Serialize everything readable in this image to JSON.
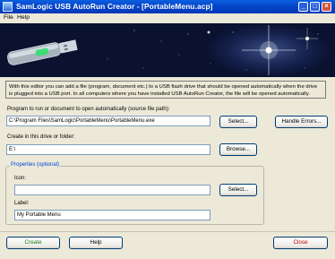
{
  "window": {
    "title": "SamLogic USB AutoRun Creator - [PortableMenu.acp]"
  },
  "menu": {
    "file": "File",
    "help": "Help"
  },
  "banner": {
    "icon": "usb-flash-drive-icon"
  },
  "info_text": "With this editor you can add a file (program, document etc.) to a USB flash drive that should be opened automatically when the drive is plugged into a USB port. In all computers where you have installed USB AutoRun Creator, the file will be opened automatically.",
  "program": {
    "label": "Program to run or document to open automatically (source file path):",
    "value": "C:\\Program Files\\SamLogic\\PortableMenu\\PortableMenu.exe",
    "select_label": "Select..."
  },
  "handle_errors_label": "Handle Errors...",
  "drive": {
    "label": "Create in this drive or folder:",
    "value": "E:\\",
    "browse_label": "Browse..."
  },
  "properties": {
    "legend": "Properties (optional)",
    "icon_label": "Icon:",
    "icon_value": "",
    "icon_select_label": "Select...",
    "label_label": "Label:",
    "label_value": "My Portable Menu"
  },
  "footer": {
    "create_label": "Create",
    "help_label": "Help",
    "close_label": "Close"
  },
  "colors": {
    "titlebar": "#0546c8",
    "create_text": "#1e7a1e",
    "close_text": "#c00000",
    "legend_text": "#0046d5"
  }
}
